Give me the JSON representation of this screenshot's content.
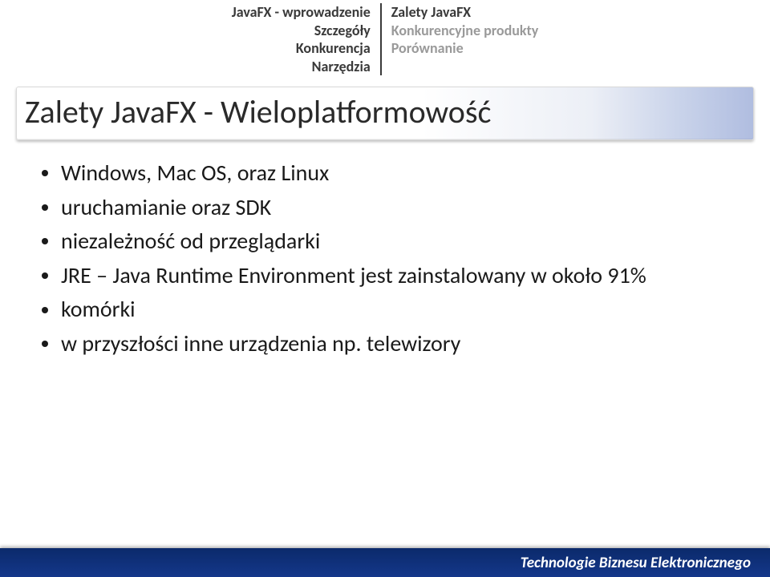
{
  "nav": {
    "left": [
      "JavaFX - wprowadzenie",
      "Szczegóły",
      "Konkurencja",
      "Narzędzia"
    ],
    "right": [
      "Zalety JavaFX",
      "Konkurencyjne produkty",
      "Porównanie"
    ],
    "right_active_index": 0
  },
  "title": "Zalety JavaFX - Wieloplatformowość",
  "bullets": [
    "Windows, Mac OS, oraz Linux",
    "uruchamianie oraz SDK",
    "niezależność od przeglądarki",
    "JRE – Java Runtime Environment jest zainstalowany w około 91%",
    "komórki",
    "w przyszłości inne urządzenia np. telewizory"
  ],
  "footer": "Technologie Biznesu Elektronicznego"
}
